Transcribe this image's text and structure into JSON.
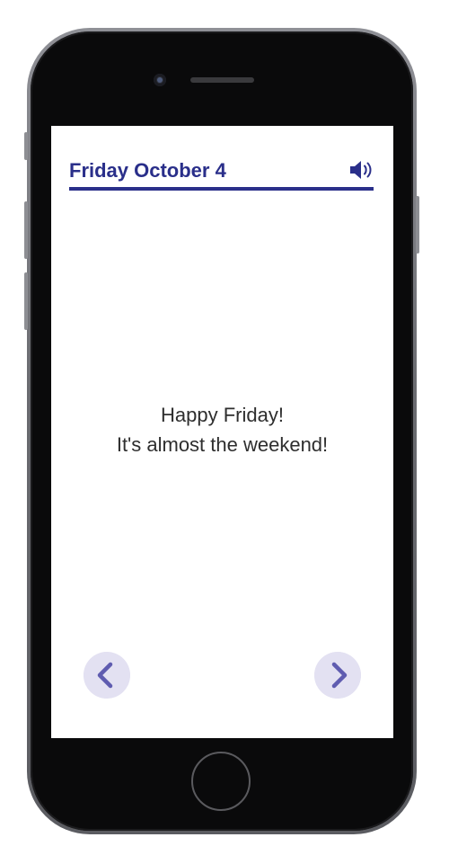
{
  "header": {
    "title": "Friday October 4",
    "audio_icon": "speaker-volume-icon"
  },
  "message": {
    "line1": "Happy Friday!",
    "line2": "It's almost the weekend!"
  },
  "navigation": {
    "previous_icon": "chevron-left-icon",
    "next_icon": "chevron-right-icon"
  },
  "colors": {
    "accent": "#2a2f8a",
    "nav_button_background": "#e3e1f2",
    "nav_chevron": "#5f5cb0",
    "message_text": "#2e2e2e",
    "device_body": "#0a0a0b"
  }
}
